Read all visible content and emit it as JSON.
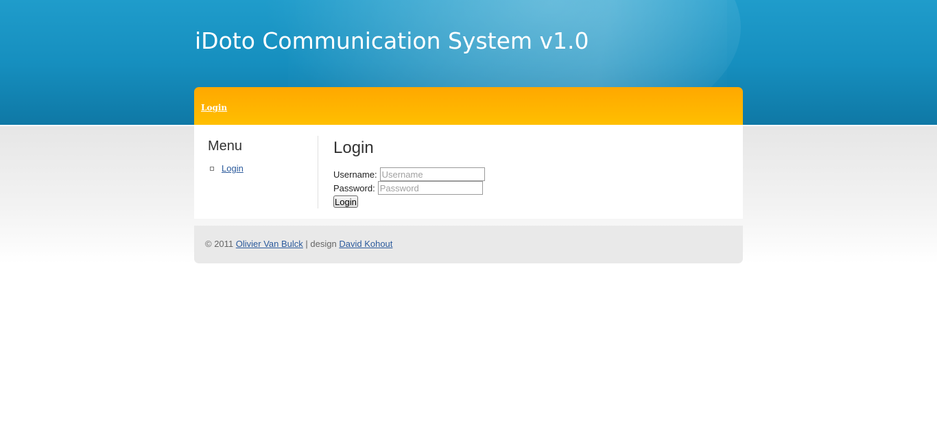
{
  "header": {
    "title": "iDoto Communication System v1.0"
  },
  "nav": {
    "items": [
      {
        "label": "Login"
      }
    ]
  },
  "sidebar": {
    "heading": "Menu",
    "items": [
      {
        "label": "Login"
      }
    ]
  },
  "login_form": {
    "heading": "Login",
    "username_label": "Username:",
    "username_placeholder": "Username",
    "password_label": "Password:",
    "password_placeholder": "Password",
    "submit_label": "Login"
  },
  "footer": {
    "copyright": "© 2011",
    "author_link": "Olivier Van Bulck",
    "separator": "| design",
    "designer_link": "David Kohout"
  },
  "colors": {
    "header_blue": "#1a93c4",
    "nav_orange": "#ffb400",
    "link_blue": "#2b5a9c",
    "footer_grey": "#e9e9e9"
  }
}
